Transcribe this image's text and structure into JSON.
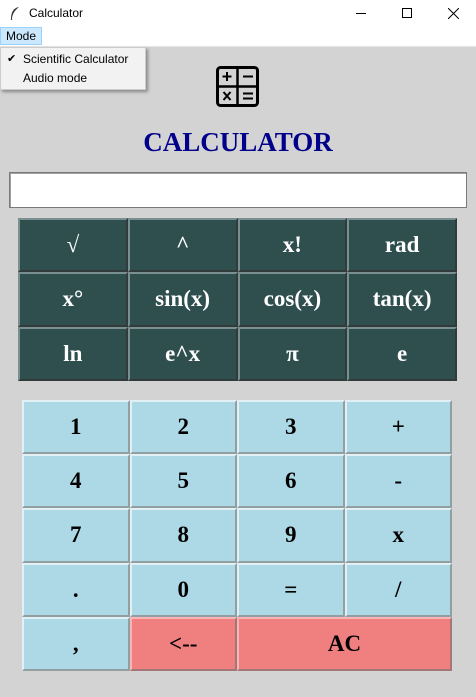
{
  "window": {
    "title": "Calculator",
    "controls": [
      "minimize-icon",
      "maximize-icon",
      "close-icon"
    ]
  },
  "menu": {
    "mode_label": "Mode",
    "items": [
      {
        "label": "Scientific Calculator",
        "checked": true
      },
      {
        "label": "Audio mode",
        "checked": false
      }
    ],
    "check_glyph": "✔"
  },
  "app": {
    "icon": "calculator-icon",
    "heading": "CALCULATOR",
    "display_value": ""
  },
  "scientific_buttons": [
    "√",
    "^",
    "x!",
    "rad",
    "x°",
    "sin(x)",
    "cos(x)",
    "tan(x)",
    "ln",
    "e^x",
    "π",
    "e"
  ],
  "keypad": {
    "rows": [
      [
        "1",
        "2",
        "3",
        "+"
      ],
      [
        "4",
        "5",
        "6",
        "-"
      ],
      [
        "7",
        "8",
        "9",
        "x"
      ],
      [
        ".",
        "0",
        "=",
        "/"
      ]
    ],
    "comma": ",",
    "backspace": "<--",
    "clear": "AC"
  },
  "colors": {
    "background": "#d3d3d3",
    "heading": "#00008b",
    "scientific_button": "#2f4f4f",
    "number_button": "#add8e6",
    "action_button": "#f08080"
  }
}
